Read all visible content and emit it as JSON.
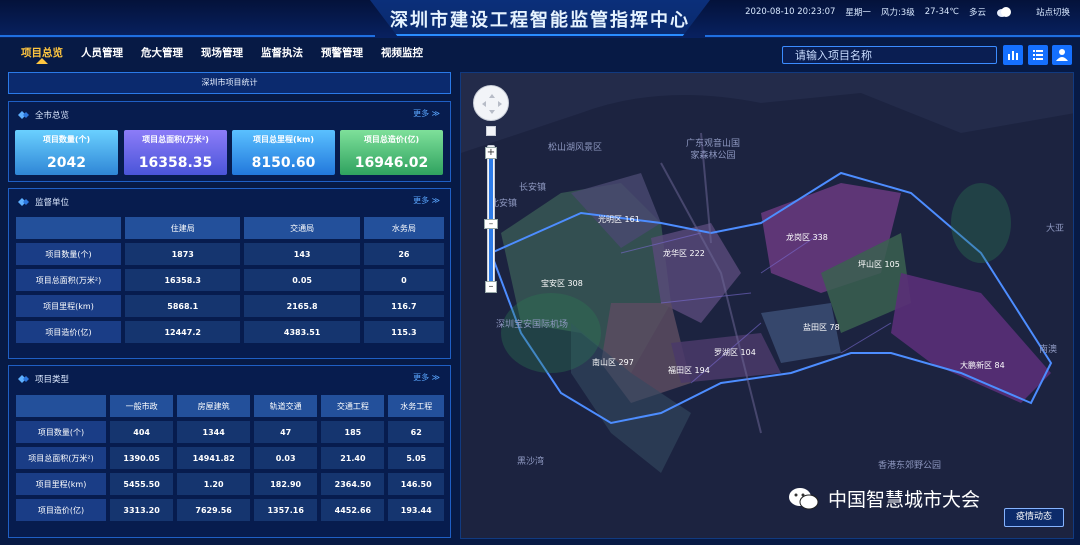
{
  "header": {
    "title": "深圳市建设工程智能监管指挥中心",
    "datetime": "2020-08-10 20:23:07",
    "weekday": "星期一",
    "wind": "风力:3级",
    "temperature": "27-34℃",
    "weather": "多云",
    "site_switch": "站点切换"
  },
  "nav": [
    "项目总览",
    "人员管理",
    "危大管理",
    "现场管理",
    "监督执法",
    "预警管理",
    "视频监控"
  ],
  "search": {
    "placeholder": "请输入项目名称"
  },
  "left": {
    "stats_header": "深圳市项目统计",
    "overview": {
      "title": "全市总览",
      "more": "更多",
      "cards": [
        {
          "label": "项目数量(个)",
          "value": "2042",
          "color": "#4fb4f5"
        },
        {
          "label": "项目总面积(万米²)",
          "value": "16358.35",
          "color": "#6a6cf0"
        },
        {
          "label": "项目总里程(km)",
          "value": "8150.60",
          "color": "#3aa6f3"
        },
        {
          "label": "项目总造价(亿)",
          "value": "16946.02",
          "color": "#53c27a"
        }
      ]
    },
    "supervision": {
      "title": "监督单位",
      "more": "更多",
      "columns": [
        "",
        "住建局",
        "交通局",
        "水务局"
      ],
      "rows": [
        {
          "label": "项目数量(个)",
          "values": [
            "1873",
            "143",
            "26"
          ]
        },
        {
          "label": "项目总面积(万米²)",
          "values": [
            "16358.3",
            "0.05",
            "0"
          ]
        },
        {
          "label": "项目里程(km)",
          "values": [
            "5868.1",
            "2165.8",
            "116.7"
          ]
        },
        {
          "label": "项目造价(亿)",
          "values": [
            "12447.2",
            "4383.51",
            "115.3"
          ]
        }
      ]
    },
    "types": {
      "title": "项目类型",
      "more": "更多",
      "columns": [
        "",
        "一般市政",
        "房屋建筑",
        "轨道交通",
        "交通工程",
        "水务工程"
      ],
      "rows": [
        {
          "label": "项目数量(个)",
          "values": [
            "404",
            "1344",
            "47",
            "185",
            "62"
          ]
        },
        {
          "label": "项目总面积(万米²)",
          "values": [
            "1390.05",
            "14941.82",
            "0.03",
            "21.40",
            "5.05"
          ]
        },
        {
          "label": "项目里程(km)",
          "values": [
            "5455.50",
            "1.20",
            "182.90",
            "2364.50",
            "146.50"
          ]
        },
        {
          "label": "项目造价(亿)",
          "values": [
            "3313.20",
            "7629.56",
            "1357.16",
            "4452.66",
            "193.44"
          ]
        }
      ]
    }
  },
  "map": {
    "districts": [
      {
        "label": "光明区 161"
      },
      {
        "label": "龙华区 222"
      },
      {
        "label": "龙岗区 338"
      },
      {
        "label": "坪山区 105"
      },
      {
        "label": "宝安区 308"
      },
      {
        "label": "盐田区 78"
      },
      {
        "label": "罗湖区 104"
      },
      {
        "label": "南山区 297"
      },
      {
        "label": "福田区 194"
      },
      {
        "label": "大鹏新区 84"
      }
    ],
    "places": [
      "深圳宝安国际机场",
      "松山湖风景区",
      "广东观音山国家森林公园",
      "南澳",
      "黑沙湾",
      "香港东郊野公园",
      "大亚",
      "长安镇",
      "北安镇"
    ],
    "button": "疫情动态"
  },
  "watermark": "中国智慧城市大会"
}
